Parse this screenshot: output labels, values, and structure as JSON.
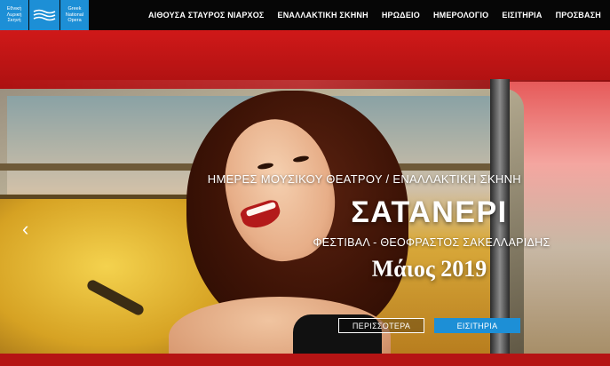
{
  "logo": {
    "greek_lines": [
      "Εθνική",
      "Λυρική",
      "Σκηνή"
    ],
    "english_lines": [
      "Greek",
      "National",
      "Opera"
    ],
    "brand_color": "#1d8fd6"
  },
  "nav": {
    "items": [
      {
        "label": "ΑΙΘΟΥΣΑ ΣΤΑΥΡΟΣ ΝΙΑΡΧΟΣ"
      },
      {
        "label": "ΕΝΑΛΛΑΚΤΙΚΗ ΣΚΗΝΗ"
      },
      {
        "label": "ΗΡΩΔΕΙΟ"
      },
      {
        "label": "ΗΜΕΡΟΛΟΓΙΟ"
      },
      {
        "label": "ΕΙΣΙΤΗΡΙΑ"
      },
      {
        "label": "ΠΡΟΣΒΑΣΗ"
      }
    ]
  },
  "hero": {
    "subtitle": "ΗΜΕΡΕΣ ΜΟΥΣΙΚΟΥ ΘΕΑΤΡΟΥ / ΕΝΑΛΛΑΚΤΙΚΗ ΣΚΗΝΗ",
    "title": "ΣΑΤΑΝΕΡΙ",
    "festival": "ΦΕΣΤΙΒΑΛ - ΘΕΟΦΡΑΣΤΟΣ ΣΑΚΕΛΛΑΡΙΔΗΣ",
    "date": "Μάιος 2019",
    "more_button": "ΠΕΡΙΣΣΟΤΕΡΑ",
    "tickets_button": "ΕΙΣΙΤΗΡΙΑ",
    "prev_icon": "chevron-left-icon"
  }
}
